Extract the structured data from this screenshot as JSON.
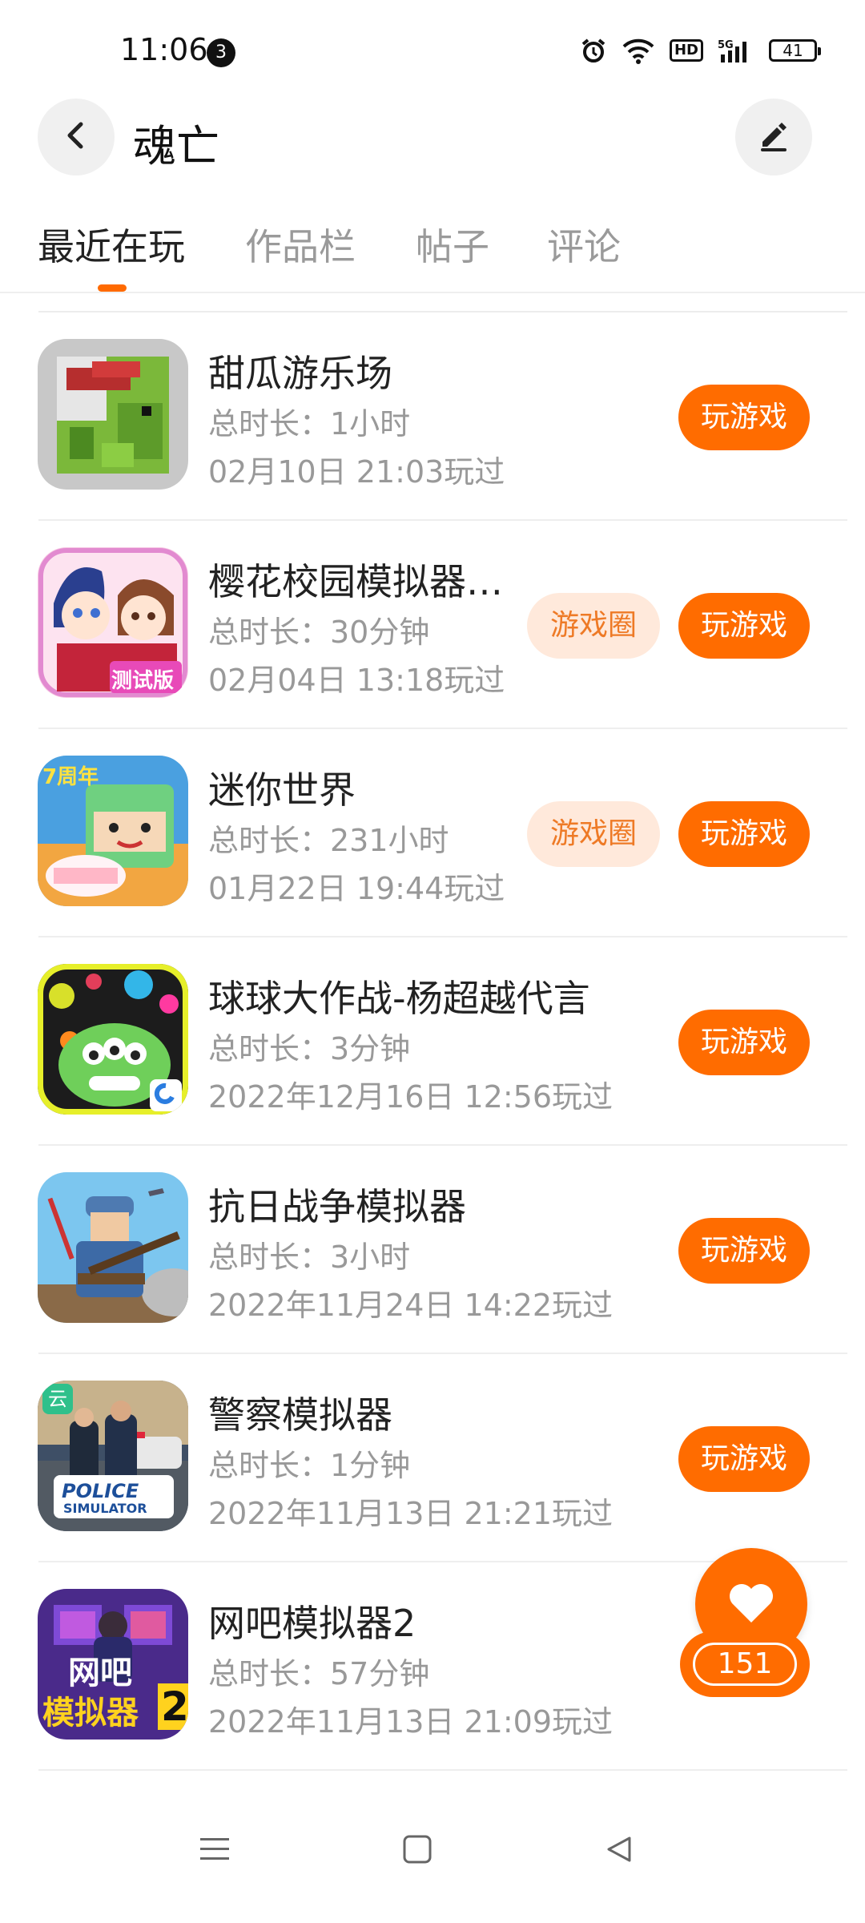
{
  "status_bar": {
    "time": "11:06",
    "notification_count": "3",
    "network": "HD",
    "signal": "5G",
    "battery": "41"
  },
  "header": {
    "title": "魂亡"
  },
  "tabs": [
    {
      "label": "最近在玩",
      "active": true
    },
    {
      "label": "作品栏",
      "active": false
    },
    {
      "label": "帖子",
      "active": false
    },
    {
      "label": "评论",
      "active": false
    }
  ],
  "games": [
    {
      "name": "甜瓜游乐场",
      "duration": "总时长：1小时",
      "last_played": "02月10日 21:03玩过",
      "has_circle": false,
      "icon": "melon-playground-icon"
    },
    {
      "name": "樱花校园模拟器…",
      "duration": "总时长：30分钟",
      "last_played": "02月04日 13:18玩过",
      "has_circle": true,
      "icon": "sakura-school-icon",
      "icon_badge": "测试版"
    },
    {
      "name": "迷你世界",
      "duration": "总时长：231小时",
      "last_played": "01月22日 19:44玩过",
      "has_circle": true,
      "icon": "mini-world-icon",
      "icon_badge": "7周年"
    },
    {
      "name": "球球大作战-杨超越代言",
      "duration": "总时长：3分钟",
      "last_played": "2022年12月16日 12:56玩过",
      "has_circle": false,
      "icon": "ball-battle-icon"
    },
    {
      "name": "抗日战争模拟器",
      "duration": "总时长：3小时",
      "last_played": "2022年11月24日 14:22玩过",
      "has_circle": false,
      "icon": "war-simulator-icon"
    },
    {
      "name": "警察模拟器",
      "duration": "总时长：1分钟",
      "last_played": "2022年11月13日 21:21玩过",
      "has_circle": false,
      "icon": "police-simulator-icon",
      "icon_badge": "云",
      "icon_logo": "POLICE",
      "icon_logo_sub": "SIMULATOR"
    },
    {
      "name": "网吧模拟器2",
      "duration": "总时长：57分钟",
      "last_played": "2022年11月13日 21:09玩过",
      "has_circle": false,
      "icon": "internet-cafe-icon",
      "icon_text_1": "网吧",
      "icon_text_2": "模拟器",
      "icon_text_3": "2"
    }
  ],
  "buttons": {
    "play": "玩游戏",
    "circle": "游戏圈"
  },
  "like": {
    "count": "151"
  },
  "colors": {
    "accent": "#ff6c00",
    "circle_bg": "#ffe9db",
    "circle_text": "#ee7a26"
  }
}
